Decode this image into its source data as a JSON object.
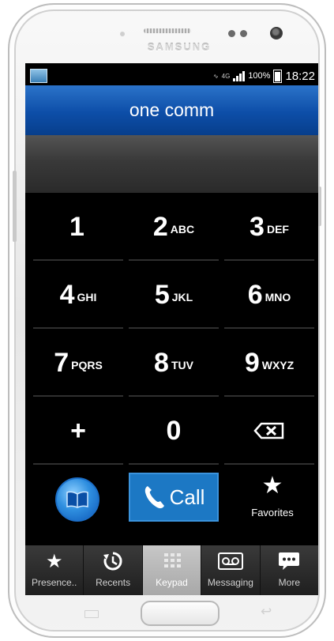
{
  "device": {
    "brand": "SAMSUNG"
  },
  "statusbar": {
    "time": "18:22",
    "battery": "100%",
    "network": "4G"
  },
  "app": {
    "title": "one comm"
  },
  "dialer": {
    "number": ""
  },
  "keys": [
    {
      "digit": "1",
      "letters": ""
    },
    {
      "digit": "2",
      "letters": "ABC"
    },
    {
      "digit": "3",
      "letters": "DEF"
    },
    {
      "digit": "4",
      "letters": "GHI"
    },
    {
      "digit": "5",
      "letters": "JKL"
    },
    {
      "digit": "6",
      "letters": "MNO"
    },
    {
      "digit": "7",
      "letters": "PQRS"
    },
    {
      "digit": "8",
      "letters": "TUV"
    },
    {
      "digit": "9",
      "letters": "WXYZ"
    },
    {
      "digit": "+",
      "letters": ""
    },
    {
      "digit": "0",
      "letters": ""
    }
  ],
  "actions": {
    "call_label": "Call",
    "favorites_label": "Favorites"
  },
  "tabs": [
    {
      "label": "Presence..",
      "icon": "star-icon"
    },
    {
      "label": "Recents",
      "icon": "recents-icon"
    },
    {
      "label": "Keypad",
      "icon": "keypad-icon"
    },
    {
      "label": "Messaging",
      "icon": "voicemail-icon"
    },
    {
      "label": "More",
      "icon": "chat-bubble-icon"
    }
  ],
  "colors": {
    "title_bar": "#0d4ea8",
    "call_button": "#1c78c4",
    "active_tab": "#b5b5b5"
  }
}
